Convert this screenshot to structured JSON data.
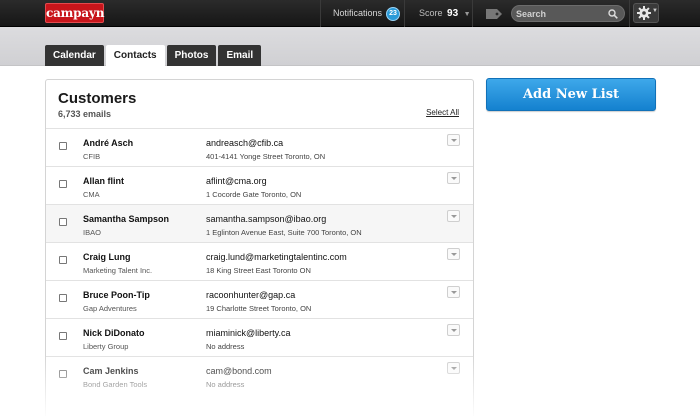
{
  "brand": {
    "logo_text": "campayn"
  },
  "topbar": {
    "notifications_label": "Notifications",
    "notifications_count": "23",
    "score_label": "Score",
    "score_value": "93",
    "search_placeholder": "Search",
    "icons": [
      "tag-icon",
      "search-icon",
      "gear-icon",
      "chevron-down-icon"
    ]
  },
  "tabs": [
    {
      "label": "Calendar"
    },
    {
      "label": "Contacts",
      "active": true
    },
    {
      "label": "Photos"
    },
    {
      "label": "Email"
    }
  ],
  "list": {
    "title": "Customers",
    "count": "6,733 emails",
    "select_all": "Select All",
    "rows": [
      {
        "name": "André Asch",
        "org": "CFIB",
        "email": "andreasch@cfib.ca",
        "address": "401-4141 Yonge Street Toronto, ON"
      },
      {
        "name": "Allan flint",
        "org": "CMA",
        "email": "aflint@cma.org",
        "address": "1 Cocorde Gate Toronto, ON"
      },
      {
        "name": "Samantha Sampson",
        "org": "IBAO",
        "email": "samantha.sampson@ibao.org",
        "address": "1 Eglinton Avenue East, Suite 700 Toronto, ON"
      },
      {
        "name": "Craig Lung",
        "org": "Marketing Talent Inc.",
        "email": "craig.lund@marketingtalentinc.com",
        "address": "18 King Street East Toronto ON"
      },
      {
        "name": "Bruce Poon-Tip",
        "org": "Gap Adventures",
        "email": "racoonhunter@gap.ca",
        "address": "19 Charlotte Street Toronto, ON"
      },
      {
        "name": "Nick DiDonato",
        "org": "Liberty Group",
        "email": "miaminick@liberty.ca",
        "address": "No address"
      },
      {
        "name": "Cam Jenkins",
        "org": "Bond Garden Tools",
        "email": "cam@bond.com",
        "address": "No address"
      },
      {
        "name": "",
        "org": "",
        "email": "",
        "address": ""
      }
    ]
  },
  "add_list_button": "Add New List",
  "colors": {
    "brand_red": "#c8151b",
    "accent_blue": "#1f8fdd",
    "topbar_dark": "#1e1e1e",
    "badge_blue": "#2a9ad8"
  }
}
